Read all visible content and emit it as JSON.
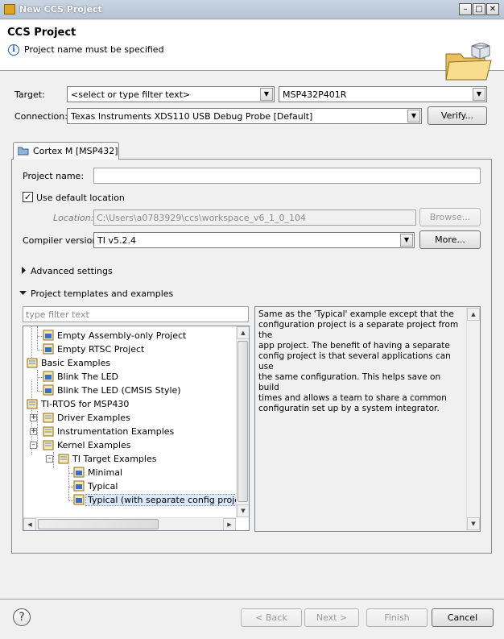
{
  "window": {
    "title": "New CCS Project"
  },
  "banner": {
    "title": "CCS Project",
    "message": "Project name must be specified"
  },
  "target": {
    "label": "Target:",
    "filter_placeholder": "<select or type filter text>",
    "device": "MSP432P401R"
  },
  "connection": {
    "label": "Connection:",
    "value": "Texas Instruments XDS110 USB Debug Probe [Default]",
    "verify_button": "Verify..."
  },
  "tab": {
    "label": "Cortex M [MSP432]"
  },
  "project": {
    "name_label": "Project name:",
    "name_value": "",
    "use_default_location": "Use default location",
    "use_default_checked": true,
    "location_label": "Location:",
    "location_value": "C:\\Users\\a0783929\\ccs\\workspace_v6_1_0_104",
    "browse_button": "Browse...",
    "compiler_label": "Compiler version:",
    "compiler_value": "TI v5.2.4",
    "more_button": "More..."
  },
  "sections": {
    "advanced": "Advanced settings",
    "templates": "Project templates and examples"
  },
  "templates": {
    "filter_placeholder": "type filter text",
    "tree": [
      {
        "label": "Empty Assembly-only Project"
      },
      {
        "label": "Empty RTSC Project"
      },
      {
        "label": "Basic Examples"
      },
      {
        "label": "Blink The LED"
      },
      {
        "label": "Blink The LED (CMSIS Style)"
      },
      {
        "label": "TI-RTOS for MSP430"
      },
      {
        "label": "Driver Examples"
      },
      {
        "label": "Instrumentation Examples"
      },
      {
        "label": "Kernel Examples"
      },
      {
        "label": "TI Target Examples"
      },
      {
        "label": "Minimal"
      },
      {
        "label": "Typical"
      },
      {
        "label": "Typical (with separate config project)"
      }
    ],
    "description": "Same as the 'Typical' example except that the\nconfiguration project is a separate project from the\napp project.  The benefit of having a separate\nconfig project is that several applications can use\nthe same configuration.  This helps save on build\ntimes and allows a team to share a common\nconfiguratin set up by a system integrator."
  },
  "footer": {
    "back": "< Back",
    "next": "Next >",
    "finish": "Finish",
    "cancel": "Cancel"
  }
}
